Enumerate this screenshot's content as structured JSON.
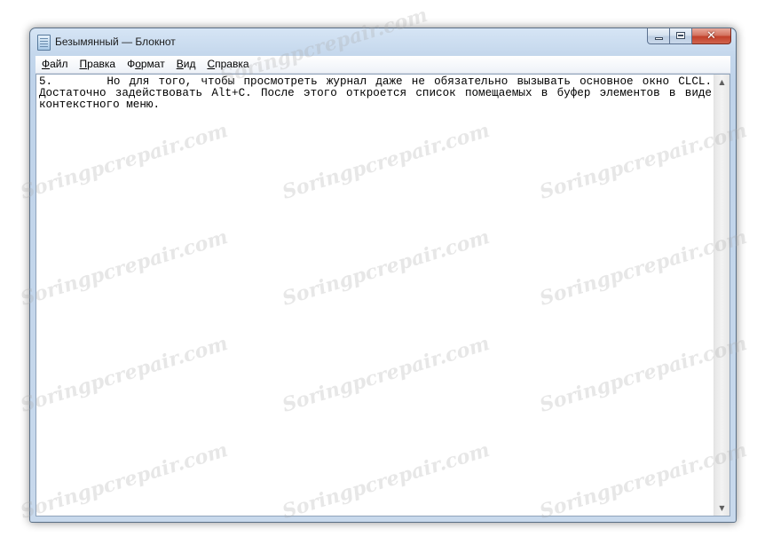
{
  "window": {
    "title": "Безымянный — Блокнот",
    "close_glyph": "✕"
  },
  "menu": [
    {
      "label": "Файл",
      "hotkey": "Ф",
      "rest": "айл"
    },
    {
      "label": "Правка",
      "hotkey": "П",
      "rest": "равка"
    },
    {
      "label": "Формат",
      "hotkey": "Ф",
      "rest": "ормат",
      "hotkey_pos": 1
    },
    {
      "label": "Вид",
      "hotkey": "В",
      "rest": "ид"
    },
    {
      "label": "Справка",
      "hotkey": "С",
      "rest": "правка"
    }
  ],
  "editor": {
    "content": "5.      Но для того, чтобы просмотреть журнал даже не обязательно вызывать основное окно CLCL. Достаточно задействовать Alt+C. После этого откроется список помещаемых в буфер элементов в виде контекстного меню."
  },
  "scrollbar": {
    "up_arrow": "▲",
    "down_arrow": "▼"
  },
  "watermark": {
    "text": "Soringpcrepair.com"
  },
  "icons": [
    "notepad-app-icon",
    "minimize-icon",
    "maximize-icon",
    "close-icon",
    "scroll-up-icon",
    "scroll-down-icon"
  ]
}
